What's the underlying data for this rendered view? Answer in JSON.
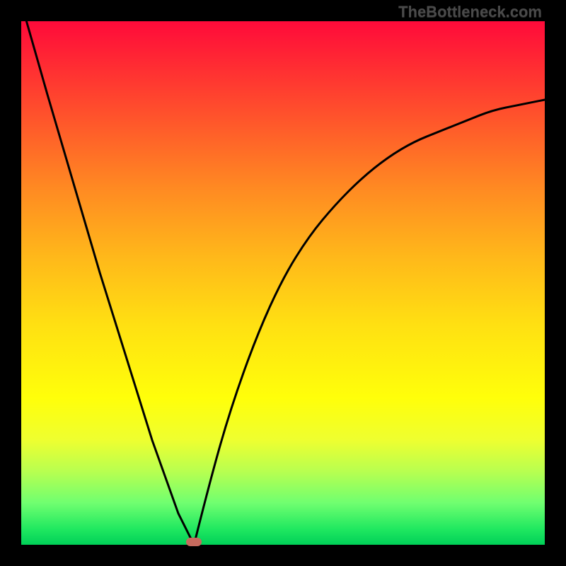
{
  "watermark": "TheBottleneck.com",
  "chart_data": {
    "type": "line",
    "title": "",
    "xlabel": "",
    "ylabel": "",
    "xlim": [
      0,
      100
    ],
    "ylim": [
      0,
      100
    ],
    "grid": false,
    "legend": false,
    "background_gradient": {
      "top": "#ff0a3a",
      "mid": "#ffff0a",
      "bottom": "#00d058"
    },
    "series": [
      {
        "name": "left-branch",
        "x": [
          1,
          5,
          10,
          15,
          20,
          25,
          30,
          33
        ],
        "y": [
          100,
          86,
          69,
          52,
          36,
          20,
          6,
          0
        ]
      },
      {
        "name": "right-branch",
        "x": [
          33,
          36,
          40,
          45,
          50,
          55,
          60,
          65,
          70,
          75,
          80,
          85,
          90,
          95,
          100
        ],
        "y": [
          0,
          12,
          26,
          40,
          51,
          59,
          65,
          70,
          74,
          77,
          79,
          81,
          83,
          84,
          85
        ]
      }
    ],
    "vertex": {
      "x": 33,
      "y": 0
    },
    "marker": {
      "x": 33,
      "y": 0,
      "color": "#c66a5e"
    }
  }
}
